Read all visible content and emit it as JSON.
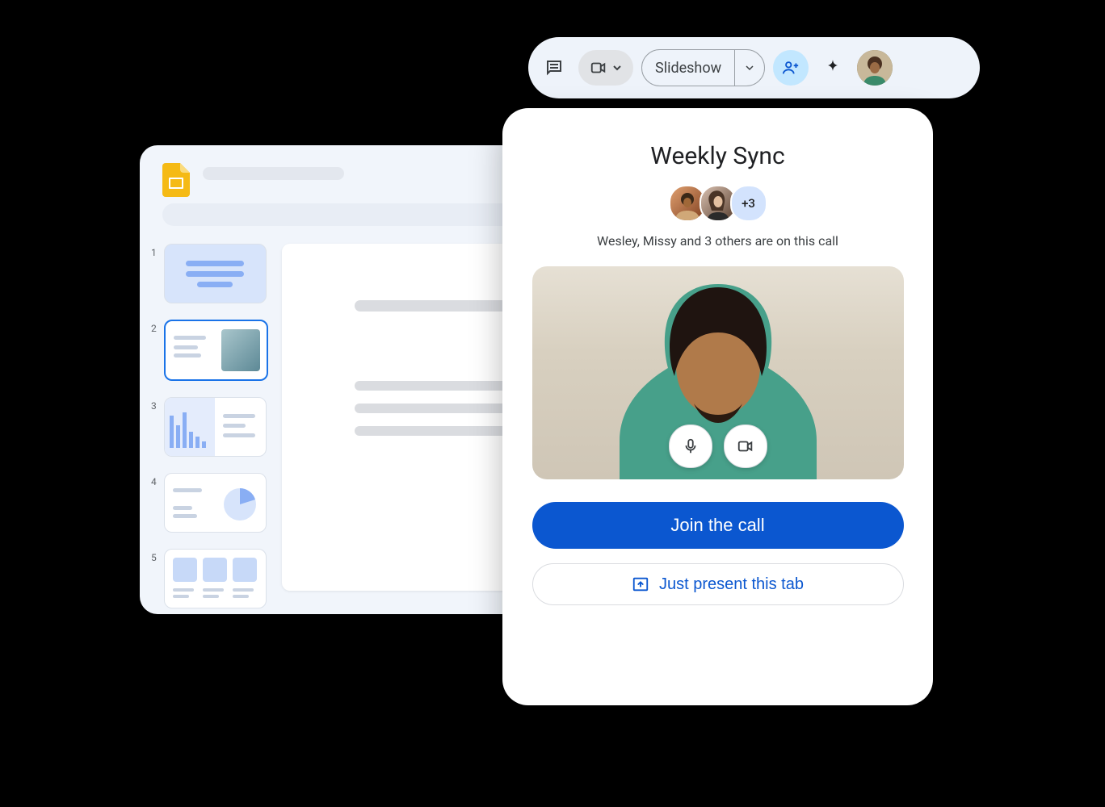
{
  "toolbar": {
    "slideshow_label": "Slideshow"
  },
  "slides": {
    "thumbnails": [
      {
        "num": "1"
      },
      {
        "num": "2"
      },
      {
        "num": "3"
      },
      {
        "num": "4"
      },
      {
        "num": "5"
      }
    ]
  },
  "meet": {
    "title": "Weekly Sync",
    "more_count": "+3",
    "subtitle": "Wesley, Missy and 3 others are on this call",
    "join_label": "Join the call",
    "present_label": "Just present this tab"
  }
}
